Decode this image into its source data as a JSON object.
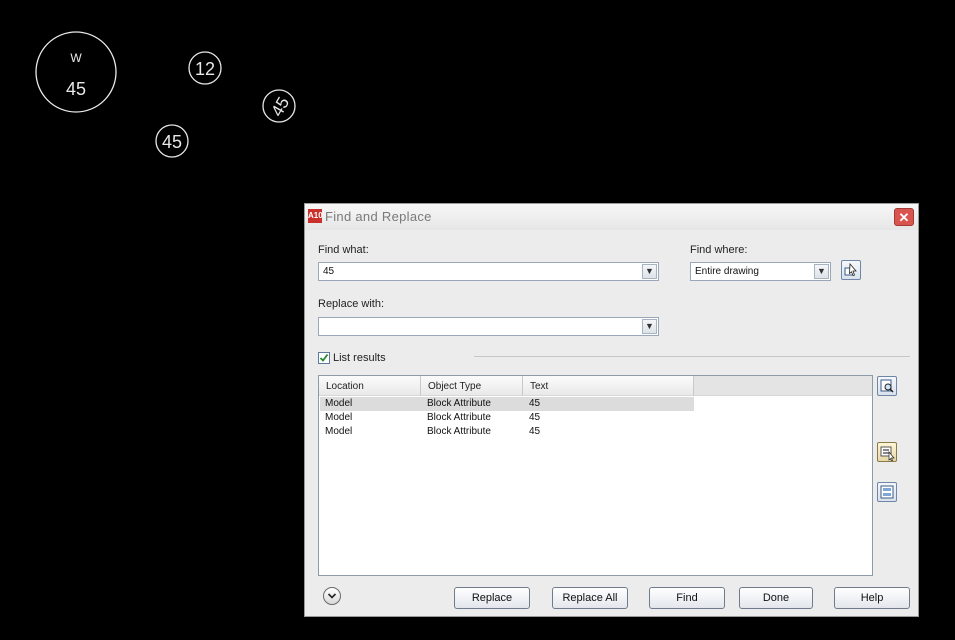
{
  "canvas": {
    "circle1_top": "W",
    "circle1_bottom": "45",
    "circle2": "12",
    "circle3": "45",
    "circle4": "45"
  },
  "dialog": {
    "title": "Find and Replace",
    "app_icon_text": "A10",
    "find_what_label": "Find what:",
    "find_what_value": "45",
    "replace_with_label": "Replace with:",
    "replace_with_value": "",
    "find_where_label": "Find where:",
    "find_where_value": "Entire drawing",
    "list_results_label": "List results",
    "list_results_checked": true,
    "columns": [
      "Location",
      "Object Type",
      "Text"
    ],
    "rows": [
      {
        "location": "Model",
        "type": "Block Attribute",
        "text": "45"
      },
      {
        "location": "Model",
        "type": "Block Attribute",
        "text": "45"
      },
      {
        "location": "Model",
        "type": "Block Attribute",
        "text": "45"
      }
    ],
    "buttons": {
      "replace": "Replace",
      "replace_all": "Replace All",
      "find": "Find",
      "done": "Done",
      "help": "Help"
    }
  }
}
